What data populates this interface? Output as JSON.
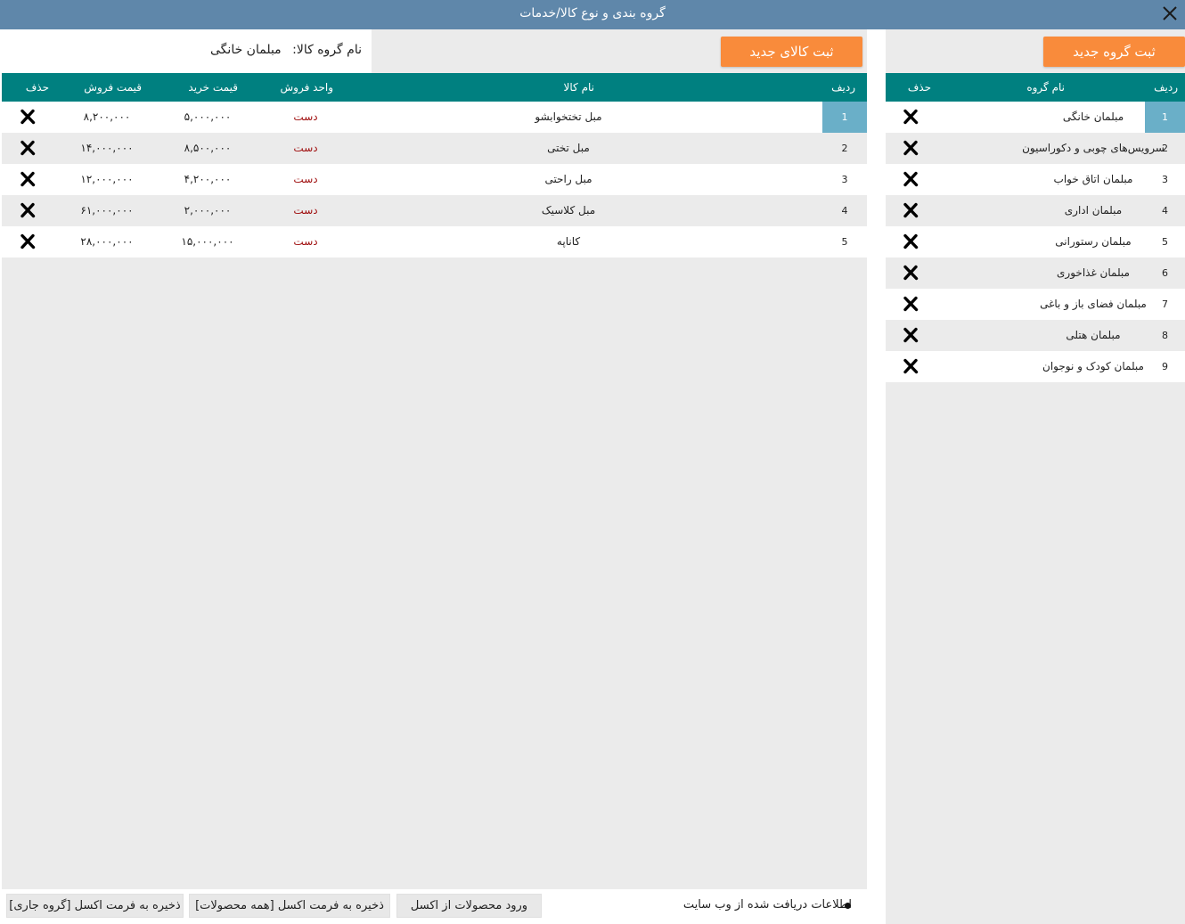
{
  "window": {
    "title": "گروه بندی و نوع کالا/خدمات"
  },
  "groups_panel": {
    "new_button": "ثبت گروه جدید",
    "headers": {
      "row": "ردیف",
      "name": "نام گروه",
      "delete": "حذف"
    },
    "rows": [
      {
        "num": "1",
        "name": "مبلمان خانگی",
        "selected": true
      },
      {
        "num": "2",
        "name": "سرویس‌های چوبی و دکوراسیون"
      },
      {
        "num": "3",
        "name": "مبلمان اتاق خواب"
      },
      {
        "num": "4",
        "name": "مبلمان اداری"
      },
      {
        "num": "5",
        "name": "مبلمان رستورانی"
      },
      {
        "num": "6",
        "name": "مبلمان غذاخوری"
      },
      {
        "num": "7",
        "name": "مبلمان فضای باز و باغی"
      },
      {
        "num": "8",
        "name": "مبلمان هتلی"
      },
      {
        "num": "9",
        "name": "مبلمان کودک و نوجوان"
      }
    ]
  },
  "products_panel": {
    "new_button": "ثبت کالای جدید",
    "group_label": "نام گروه کالا:",
    "group_value": "مبلمان خانگی",
    "headers": {
      "row": "ردیف",
      "name": "نام کالا",
      "unit": "واحد فروش",
      "buy": "قیمت خرید",
      "sell": "قیمت فروش",
      "delete": "حذف"
    },
    "rows": [
      {
        "num": "1",
        "name": "مبل تختخوابشو",
        "unit": "دست",
        "buy": "۵,۰۰۰,۰۰۰",
        "sell": "۸,۲۰۰,۰۰۰",
        "selected": true
      },
      {
        "num": "2",
        "name": "مبل تختی",
        "unit": "دست",
        "buy": "۸,۵۰۰,۰۰۰",
        "sell": "۱۴,۰۰۰,۰۰۰"
      },
      {
        "num": "3",
        "name": "مبل راحتی",
        "unit": "دست",
        "buy": "۴,۲۰۰,۰۰۰",
        "sell": "۱۲,۰۰۰,۰۰۰"
      },
      {
        "num": "4",
        "name": "مبل کلاسیک",
        "unit": "دست",
        "buy": "۲,۰۰۰,۰۰۰",
        "sell": "۶۱,۰۰۰,۰۰۰"
      },
      {
        "num": "5",
        "name": "کاناپه",
        "unit": "دست",
        "buy": "۱۵,۰۰۰,۰۰۰",
        "sell": "۲۸,۰۰۰,۰۰۰"
      }
    ]
  },
  "footer": {
    "status_text": "اطلاعات دریافت شده از وب سایت",
    "import_button": "ورود محصولات از اکسل",
    "export_all_button": "ذخیره به فرمت اکسل [همه محصولات]",
    "export_current_button": "ذخیره به فرمت اکسل [گروه جاری]"
  },
  "colors": {
    "titlebar": "#5f87aa",
    "header": "#008080",
    "accent": "#f98b3b",
    "selected_row": "#6aafc8"
  }
}
